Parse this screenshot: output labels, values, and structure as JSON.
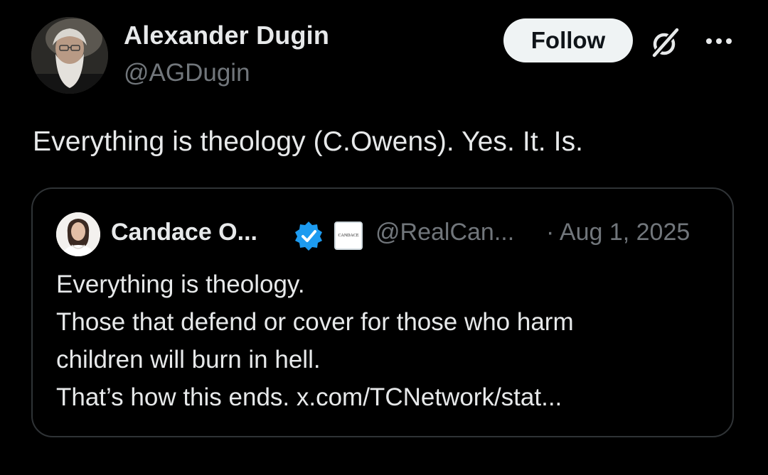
{
  "author": {
    "display_name": "Alexander Dugin",
    "handle": "@AGDugin",
    "avatar_icon": "author-avatar"
  },
  "actions": {
    "follow_label": "Follow",
    "grok_icon": "grok-icon",
    "more_icon": "more-icon"
  },
  "tweet": {
    "text": "Everything is theology (C.Owens). Yes. It. Is."
  },
  "quote": {
    "author_name": "Candace O...",
    "handle": "@RealCan...",
    "date": "· Aug 1, 2025",
    "affiliate_badge_text": "CANDACE",
    "verified_color": "#1d9bf0",
    "lines": [
      "Everything is theology.",
      "Those that defend or cover for those who harm",
      "children will burn in hell.",
      "That’s how this ends. x.com/TCNetwork/stat..."
    ]
  },
  "colors": {
    "background": "#000000",
    "primary_text": "#e7e9ea",
    "secondary_text": "#71767b",
    "border": "#2f3336",
    "follow_bg": "#eff3f4"
  }
}
